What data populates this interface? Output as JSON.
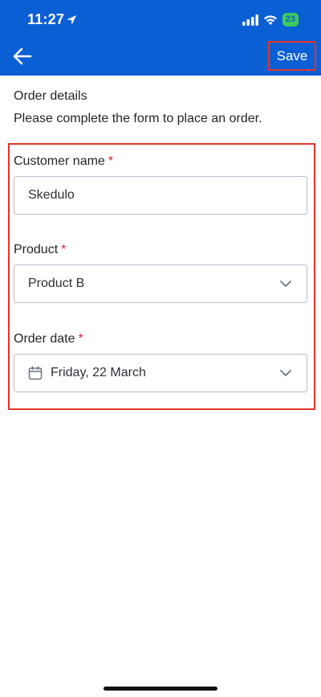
{
  "status_bar": {
    "time": "11:27",
    "battery": "23"
  },
  "header": {
    "save_label": "Save"
  },
  "intro": {
    "title": "Order details",
    "description": "Please complete the form to place an order."
  },
  "form": {
    "customer": {
      "label": "Customer name",
      "required_mark": "*",
      "value": "Skedulo"
    },
    "product": {
      "label": "Product",
      "required_mark": "*",
      "value": "Product B"
    },
    "order_date": {
      "label": "Order date",
      "required_mark": "*",
      "value": "Friday, 22 March"
    }
  },
  "colors": {
    "header_bg": "#0b5fd4",
    "highlight_border": "#e3342a",
    "required": "#d0203d"
  },
  "icons": {
    "back": "arrow-left-icon",
    "location": "location-arrow-icon",
    "signal": "signal-icon",
    "wifi": "wifi-icon",
    "battery": "battery-icon",
    "chevron": "chevron-down-icon",
    "calendar": "calendar-icon"
  }
}
